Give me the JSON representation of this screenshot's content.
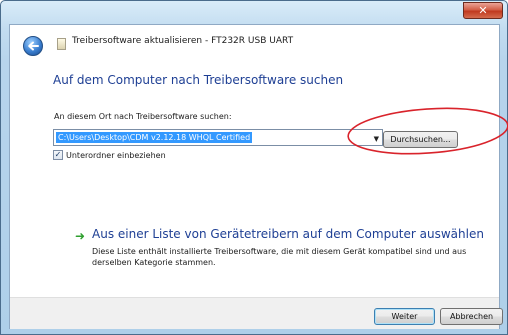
{
  "window": {
    "title": "Treibersoftware aktualisieren - FT232R USB UART",
    "close_glyph": "✕"
  },
  "page": {
    "heading": "Auf dem Computer nach Treibersoftware suchen",
    "location_label": "An diesem Ort nach Treibersoftware suchen:",
    "path_value": "C:\\Users\\Desktop\\CDM v2.12.18 WHQL Certified",
    "browse_label": "Durchsuchen...",
    "include_subfolders": {
      "label": "Unterordner einbeziehen",
      "checked": true,
      "glyph": "✓"
    },
    "pick_link": {
      "title": "Aus einer Liste von Gerätetreibern auf dem Computer auswählen",
      "description": "Diese Liste enthält installierte Treibersoftware, die mit diesem Gerät kompatibel sind und aus derselben Kategorie stammen."
    }
  },
  "footer": {
    "next_label": "Weiter",
    "cancel_label": "Abbrechen"
  },
  "icons": {
    "back": "back-arrow-icon",
    "wizard": "driver-wizard-icon",
    "dropdown": "chevron-down-icon",
    "link_arrow": "green-arrow-icon",
    "annotation": "red-ellipse-annotation"
  },
  "colors": {
    "heading": "#1e3f94",
    "selection": "#3399ff",
    "link_arrow": "#2e9f2e",
    "annotation": "#d9232b",
    "close_button": "#c0391f"
  }
}
